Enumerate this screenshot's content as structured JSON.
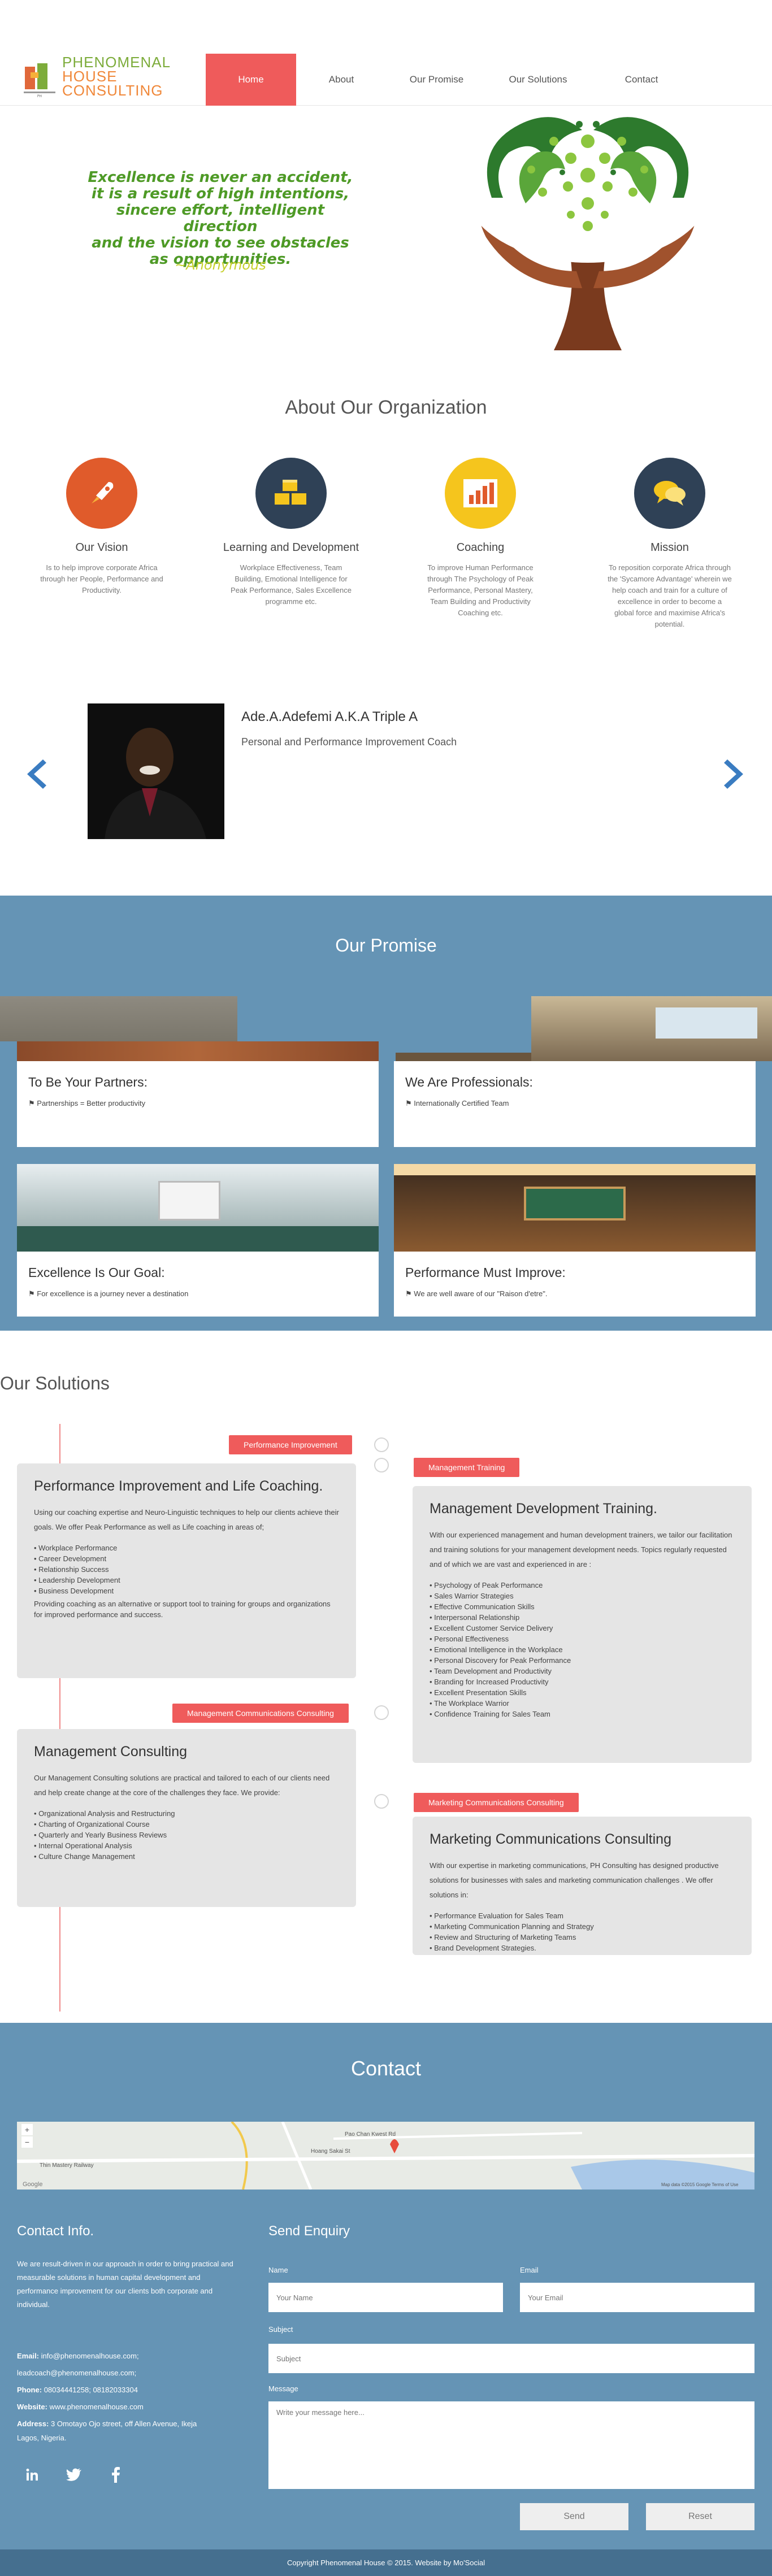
{
  "brand": {
    "line1": "PHENOMENAL",
    "line2": "HOUSE",
    "line3": "CONSULTING",
    "mark_text": "PH"
  },
  "nav": [
    {
      "label": "Home",
      "active": true
    },
    {
      "label": "About",
      "active": false
    },
    {
      "label": "Our Promise",
      "active": false
    },
    {
      "label": "Our Solutions",
      "active": false
    },
    {
      "label": "Contact",
      "active": false
    }
  ],
  "hero": {
    "quote_lines": [
      "Excellence is never an accident,",
      "it is a result of high intentions,",
      "sincere effort, intelligent direction",
      "and the vision to see obstacles",
      "as opportunities."
    ],
    "author": "~Anonymous"
  },
  "about": {
    "title": "About Our Organization",
    "features": [
      {
        "icon": "rocket-icon",
        "color": "#e05b2b",
        "title": "Our Vision",
        "text": "Is to help improve corporate Africa through her People, Performance and Productivity."
      },
      {
        "icon": "blocks-icon",
        "color": "#2f4156",
        "title": "Learning and Development",
        "text": "Workplace Effectiveness, Team Building, Emotional Intelligence for Peak Performance, Sales Excellence programme etc."
      },
      {
        "icon": "bar-chart-icon",
        "color": "#f5c51d",
        "title": "Coaching",
        "text": "To improve Human Performance through The Psychology of Peak Performance, Personal Mastery, Team Building and Productivity Coaching etc."
      },
      {
        "icon": "chat-bubbles-icon",
        "color": "#2f4156",
        "title": "Mission",
        "text": "To reposition corporate Africa through the 'Sycamore Advantage' wherein we help coach and train for a culture of excellence in order to become a global force and maximise Africa's potential."
      }
    ],
    "person": {
      "name": "Ade.A.Adefemi A.K.A Triple A",
      "role": "Personal and Performance Improvement Coach"
    }
  },
  "promise": {
    "title": "Our Promise",
    "cards": [
      {
        "title": "To Be Your Partners:",
        "text": "Partnerships = Better productivity"
      },
      {
        "title": "We Are Professionals:",
        "text": "Internationally Certified Team"
      },
      {
        "title": "Excellence Is Our Goal:",
        "text": "For excellence is a journey never a destination"
      },
      {
        "title": "Performance Must Improve:",
        "text": "We are well aware of our \"Raison d'etre\"."
      }
    ]
  },
  "solutions": {
    "title": "Our Solutions",
    "items": [
      {
        "tag": "Performance Improvement",
        "title": "Performance Improvement and Life Coaching.",
        "intro": "Using our coaching expertise and Neuro-Linguistic techniques to help our clients achieve their goals. We offer Peak Performance as well as Life coaching in areas of;",
        "list": [
          "Workplace Performance",
          "Career Development",
          "Relationship Success",
          "Leadership Development",
          "Business Development"
        ],
        "outro": "Providing coaching as an alternative or support tool to training for groups and organizations for improved performance and success."
      },
      {
        "tag": "Management Training",
        "title": "Management Development Training.",
        "intro": "With our experienced management and human development trainers, we tailor our facilitation and training solutions for your management development needs. Topics regularly requested and of which we are vast and experienced in are :",
        "list": [
          "Psychology of Peak Performance",
          "Sales Warrior Strategies",
          "Effective Communication Skills",
          "Interpersonal Relationship",
          "Excellent Customer Service Delivery",
          "Personal Effectiveness",
          "Emotional Intelligence in the Workplace",
          "Personal Discovery for Peak Performance",
          "Team Development and Productivity",
          "Branding for Increased Productivity",
          "Excellent Presentation Skills",
          "The Workplace Warrior",
          "Confidence Training for Sales Team"
        ],
        "outro": ""
      },
      {
        "tag": "Management Communications Consulting",
        "title": "Management Consulting",
        "intro": "Our Management Consulting solutions are practical and tailored to each of our clients need and help create change at the core of the challenges they face. We provide:",
        "list": [
          "Organizational Analysis and Restructuring",
          "Charting of Organizational Course",
          "Quarterly and Yearly Business Reviews",
          "Internal Operational Analysis",
          "Culture Change Management"
        ],
        "outro": ""
      },
      {
        "tag": "Marketing Communications Consulting",
        "title": "Marketing Communications Consulting",
        "intro": "With our expertise in marketing communications, PH Consulting has designed productive solutions for businesses with sales and marketing communication challenges . We offer solutions in:",
        "list": [
          "Performance Evaluation for Sales Team",
          "Marketing Communication Planning and Strategy",
          "Review and Structuring of Marketing Teams",
          "Brand Development Strategies."
        ],
        "outro": ""
      }
    ]
  },
  "contact": {
    "title": "Contact",
    "map": {
      "label_station": "Thin Mastery Railway",
      "label_road": "Pao Chan Kwest Rd",
      "label_street": "Hoang Sakai St",
      "credit": "Map data ©2015 Google   Terms of Use",
      "plus": "+",
      "minus": "−",
      "google": "Google"
    },
    "info_title": "Contact Info.",
    "info_body": "We are result-driven in our approach in order to bring practical and measurable solutions in human capital development and performance improvement for our clients both corporate and individual.",
    "email_label": "Email:",
    "email1": "info@phenomenalhouse.com;",
    "email2": "leadcoach@phenomenalhouse.com;",
    "phone_label": "Phone:",
    "phone": "08034441258; 08182033304",
    "website_label": "Website:",
    "website": "www.phenomenalhouse.com",
    "address_label": "Address:",
    "address1": "3 Omotayo Ojo street, off Allen Avenue, Ikeja",
    "address2": "Lagos, Nigeria.",
    "socials": [
      "linkedin-icon",
      "twitter-icon",
      "facebook-icon"
    ],
    "enquiry_title": "Send Enquiry",
    "name_label": "Name",
    "name_placeholder": "Your Name",
    "email_field_label": "Email",
    "email_placeholder": "Your Email",
    "subject_label": "Subject",
    "subject_placeholder": "Subject",
    "message_label": "Message",
    "message_placeholder": "Write your message here...",
    "send": "Send",
    "reset": "Reset"
  },
  "footer": "Copyright Phenomenal House © 2015. Website by Mo'Social"
}
